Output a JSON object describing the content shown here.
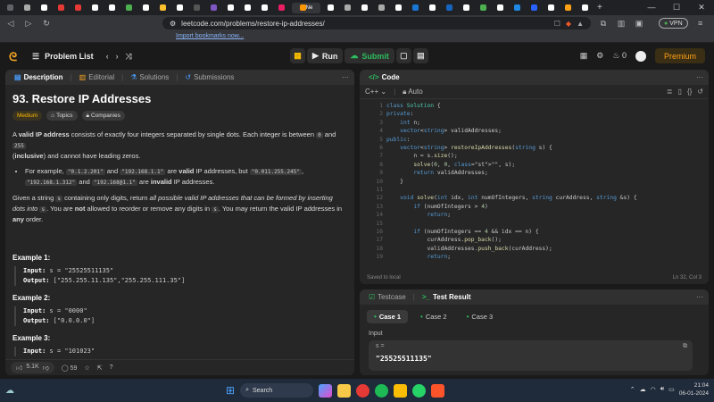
{
  "browser": {
    "url": "leetcode.com/problems/restore-ip-addresses/",
    "bookmark_link": "Import bookmarks now...",
    "vpn": "VPN",
    "tab_icons": [
      "#5f6368",
      "#aaa",
      "#fff",
      "#e53935",
      "#e53935",
      "#fff",
      "#fff",
      "#4caf50",
      "#fff",
      "#fbc02d",
      "#fff",
      "#555",
      "#7e57c2",
      "#fff",
      "#fff",
      "#fff",
      "#e91e63",
      "#ff9800",
      "#fff",
      "#aaa",
      "#fff",
      "#aaa",
      "#fff",
      "#1976d2",
      "#fff",
      "#1565c0",
      "#fff",
      "#4caf50",
      "#fff",
      "#1e88e5",
      "#2962ff",
      "#fff",
      "#ffa116",
      "#fff"
    ],
    "active_tab_label": "Ne"
  },
  "nav": {
    "problem_list": "Problem List",
    "run": "Run",
    "submit": "Submit",
    "streak": "0",
    "premium": "Premium"
  },
  "left_tabs": [
    "Description",
    "Editorial",
    "Solutions",
    "Submissions"
  ],
  "problem": {
    "title": "93. Restore IP Addresses",
    "difficulty": "Medium",
    "topics": "Topics",
    "companies": "Companies",
    "p1_a": "A ",
    "p1_b": "valid IP address",
    "p1_c": " consists of exactly four integers separated by single dots. Each integer is between ",
    "p1_d": "0",
    "p1_e": " and ",
    "p1_f": "255",
    "p1_g": " (",
    "p1_h": "inclusive",
    "p1_i": ") and cannot have leading zeros.",
    "li_a": "For example, ",
    "li_b": "\"0.1.2.201\"",
    "li_c": " and ",
    "li_d": "\"192.168.1.1\"",
    "li_e": " are ",
    "li_f": "valid",
    "li_g": " IP addresses, but ",
    "li_h": "\"0.011.255.245\"",
    "li_i": ",",
    "li_j": "\"192.168.1.312\"",
    "li_k": " and ",
    "li_l": "\"192.168@1.1\"",
    "li_m": " are ",
    "li_n": "invalid",
    "li_o": " IP addresses.",
    "p2_a": "Given a string ",
    "p2_b": "s",
    "p2_c": " containing only digits, return ",
    "p2_d": "all possible valid IP addresses that can be formed by inserting dots into",
    "p2_e": " ",
    "p2_f": "s",
    "p2_g": ". You are ",
    "p2_h": "not",
    "p2_i": " allowed to reorder or remove any digits in ",
    "p2_j": "s",
    "p2_k": ". You may return the valid IP addresses in ",
    "p2_l": "any",
    "p2_m": " order.",
    "examples": [
      {
        "h": "Example 1:",
        "in_label": "Input:",
        "in": " s = \"25525511135\"",
        "out_label": "Output:",
        "out": " [\"255.255.11.135\",\"255.255.111.35\"]"
      },
      {
        "h": "Example 2:",
        "in_label": "Input:",
        "in": " s = \"0000\"",
        "out_label": "Output:",
        "out": " [\"0.0.0.0\"]"
      },
      {
        "h": "Example 3:",
        "in_label": "Input:",
        "in": " s = \"101023\"",
        "out_label": "",
        "out": ""
      }
    ],
    "likes": "5.1K",
    "comments": "59"
  },
  "code_panel": {
    "title": "Code",
    "language": "C++",
    "mode": "Auto",
    "saved": "Saved to local",
    "cursor": "Ln 32, Col 3",
    "lines": [
      "class Solution {",
      "private:",
      "    int n;",
      "    vector<string> validAddresses;",
      "public:",
      "    vector<string> restoreIpAddresses(string s) {",
      "        n = s.size();",
      "        solve(0, 0, \"\", s);",
      "        return validAddresses;",
      "    }",
      "",
      "    void solve(int idx, int numOfIntegers, string curAddress, string &s) {",
      "        if (numOfIntegers > 4)",
      "            return;",
      "",
      "        if (numOfIntegers == 4 && idx == n) {",
      "            curAddress.pop_back();",
      "            validAddresses.push_back(curAddress);",
      "            return;"
    ]
  },
  "test_panel": {
    "tab_testcase": "Testcase",
    "tab_result": "Test Result",
    "cases": [
      "Case 1",
      "Case 2",
      "Case 3"
    ],
    "input_label": "Input",
    "var": "s =",
    "value": "\"25525511135\""
  },
  "taskbar": {
    "search": "Search",
    "time": "21:04",
    "date": "06-01-2024"
  }
}
